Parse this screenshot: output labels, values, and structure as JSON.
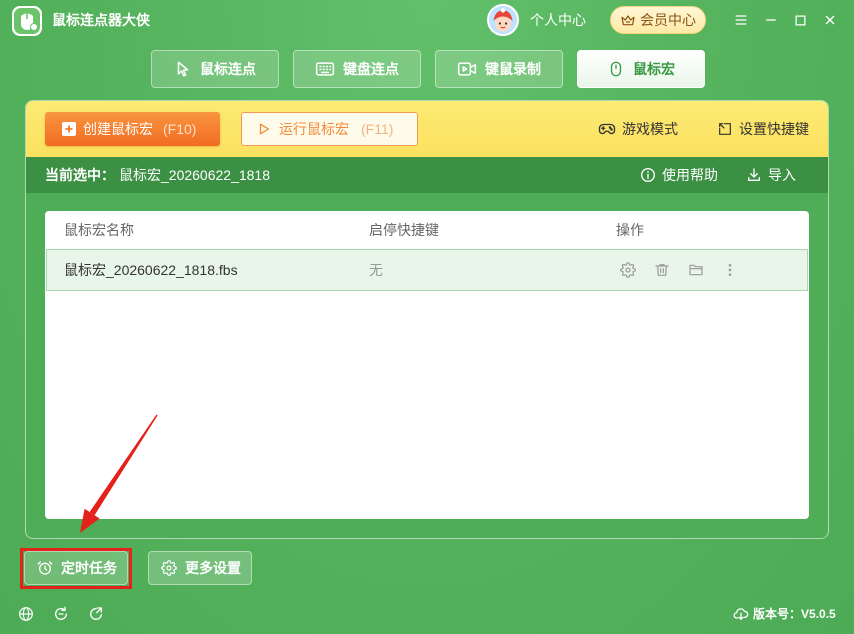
{
  "app": {
    "title": "鼠标连点器大侠",
    "logo_icon": "app-logo-icon"
  },
  "header": {
    "user_center": "个人中心",
    "vip_center": "会员中心",
    "vip_icon": "crown-icon",
    "window_controls": [
      "menu-icon",
      "minimize-icon",
      "maximize-icon",
      "close-icon"
    ]
  },
  "tabs": [
    {
      "label": "鼠标连点",
      "icon": "cursor-icon",
      "active": false
    },
    {
      "label": "键盘连点",
      "icon": "keyboard-icon",
      "active": false
    },
    {
      "label": "键鼠录制",
      "icon": "video-record-icon",
      "active": false
    },
    {
      "label": "鼠标宏",
      "icon": "mouse-icon",
      "active": true
    }
  ],
  "toolbar": {
    "create_label": "创建鼠标宏",
    "create_hotkey": "(F10)",
    "create_icon": "add-file-icon",
    "run_label": "运行鼠标宏",
    "run_hotkey": "(F11)",
    "run_icon": "play-icon",
    "game_mode_label": "游戏模式",
    "game_mode_icon": "gamepad-icon",
    "set_hotkey_label": "设置快捷键",
    "set_hotkey_icon": "hotkey-icon"
  },
  "selection": {
    "prefix": "当前选中：",
    "current": "鼠标宏_20260622_1818",
    "help_label": "使用帮助",
    "help_icon": "info-icon",
    "import_label": "导入",
    "import_icon": "import-icon"
  },
  "table": {
    "columns": [
      "鼠标宏名称",
      "启停快捷键",
      "操作"
    ],
    "rows": [
      {
        "name": "鼠标宏_20260622_1818.fbs",
        "hotkey": "无",
        "selected": true,
        "actions": [
          "gear-icon",
          "trash-icon",
          "folder-icon",
          "more-vertical-icon"
        ]
      }
    ]
  },
  "footer": {
    "scheduled_task_label": "定时任务",
    "scheduled_task_icon": "alarm-clock-icon",
    "more_settings_label": "更多设置",
    "more_settings_icon": "gear-icon"
  },
  "status_bar": {
    "icons": [
      "globe-icon",
      "sync-icon",
      "update-icon"
    ],
    "version_icon": "cloud-download-icon",
    "version_label": "版本号：",
    "version": "V5.0.5"
  },
  "colors": {
    "background_green": "#4fad57",
    "selection_bar": "#3c9044",
    "toolbar_yellow": "#fbe15f",
    "create_button_orange": "#f27a2c",
    "active_tab_text": "#3a9a43",
    "selected_row": "#e8f5e9",
    "annotation_red": "#e3221c"
  }
}
